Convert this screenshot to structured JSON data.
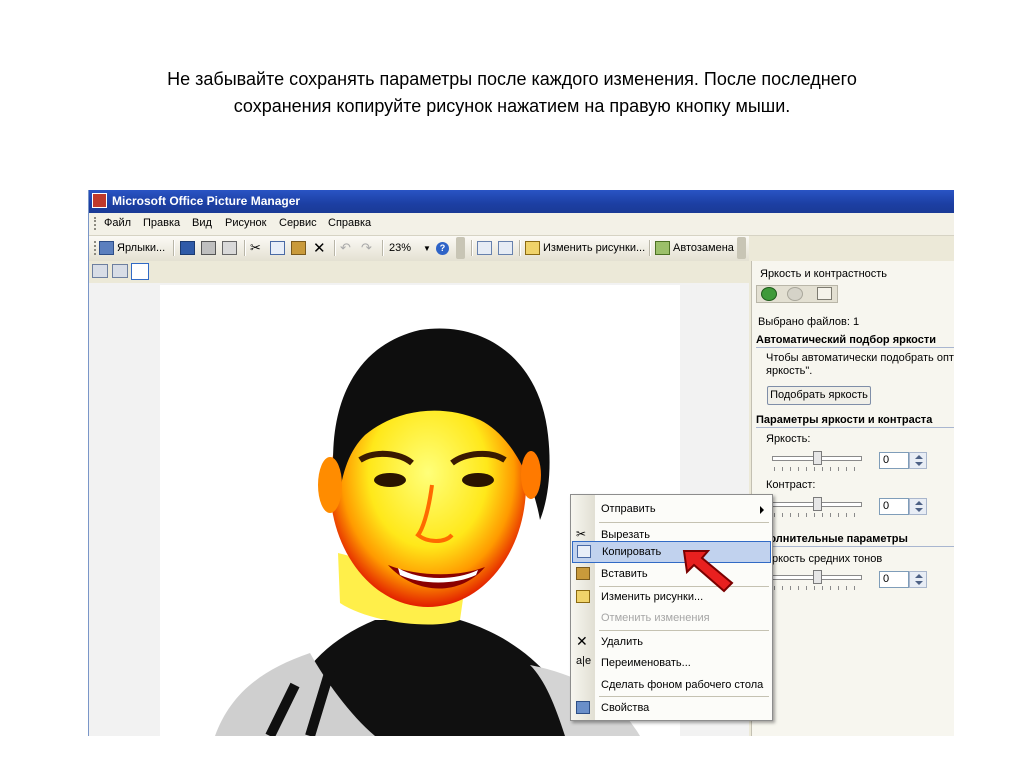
{
  "caption": {
    "line1": "Не забывайте сохранять параметры после каждого изменения. После последнего",
    "line2": "сохранения копируйте рисунок нажатием на правую кнопку мыши."
  },
  "window": {
    "title": "Microsoft Office Picture Manager"
  },
  "menu": [
    "Файл",
    "Правка",
    "Вид",
    "Рисунок",
    "Сервис",
    "Справка"
  ],
  "toolbar": {
    "shortcuts_label": "Ярлыки...",
    "zoom_value": "23%",
    "edit_pictures_label": "Изменить рисунки...",
    "autocorrect_label": "Автозамена"
  },
  "taskpane": {
    "title": "Яркость и контрастность",
    "selected_files": "Выбрано файлов: 1",
    "auto_heading": "Автоматический подбор яркости",
    "auto_desc_line1": "Чтобы автоматически подобрать опти",
    "auto_desc_line2": "яркость\".",
    "auto_button": "Подобрать яркость",
    "params_heading": "Параметры яркости и контраста",
    "brightness_label": "Яркость:",
    "brightness_value": "0",
    "contrast_label": "Контраст:",
    "contrast_value": "0",
    "extra_heading": "ополнительные параметры",
    "midtones_label": "яркость средних тонов",
    "midtones_value": "0"
  },
  "context_menu": {
    "send": "Отправить",
    "cut": "Вырезать",
    "copy": "Копировать",
    "paste": "Вставить",
    "edit": "Изменить рисунки...",
    "undo": "Отменить изменения",
    "delete": "Удалить",
    "rename": "Переименовать...",
    "wallpaper": "Сделать фоном рабочего стола",
    "properties": "Свойства"
  },
  "icons": {
    "app": "picture-manager-icon",
    "save": "save-icon",
    "print": "print-icon",
    "cut": "scissors-icon",
    "copy": "copy-icon",
    "paste": "paste-icon",
    "delete": "delete-x-icon",
    "undo": "undo-icon",
    "redo": "redo-icon",
    "help": "help-icon",
    "pointer": "red-arrow-pointer"
  },
  "colors": {
    "titlebar": "#1c3fa3",
    "highlight": "#c1d2ee",
    "arrow": "#e8201f"
  }
}
